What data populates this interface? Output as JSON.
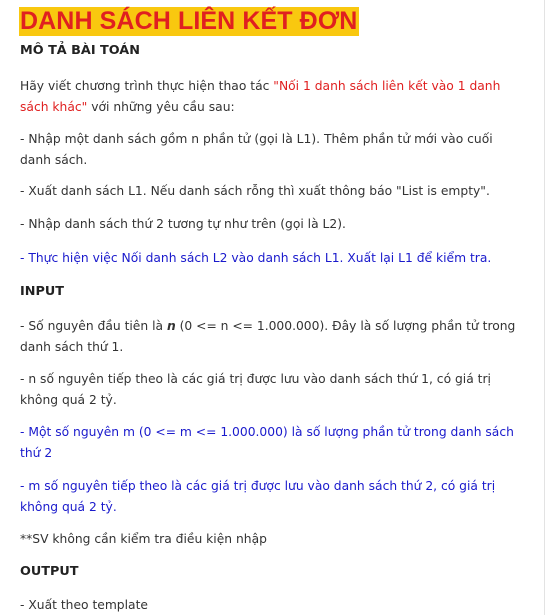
{
  "title": "DANH SÁCH LIÊN KẾT ĐƠN",
  "sections": {
    "description_heading": "MÔ TẢ BÀI TOÁN",
    "intro_prefix": "Hãy viết chương trình thực hiện thao tác ",
    "intro_highlight": "\"Nối 1 danh sách liên kết vào 1 danh sách khác\"",
    "intro_suffix": " với những yêu cầu sau:",
    "req1": "- Nhập một danh sách gồm n phần tử (gọi là L1). Thêm phần tử mới vào cuối danh sách.",
    "req2": "- Xuất danh sách L1. Nếu danh sách rỗng thì xuất thông báo \"List is empty\".",
    "req3": "- Nhập danh sách thứ 2  tương tự như trên (gọi là L2).",
    "req4": "- Thực hiện việc Nối danh sách L2 vào danh sách L1. Xuất lại L1 để kiểm tra.",
    "input_heading": "INPUT",
    "in1_prefix": " - Số nguyên đầu tiên là ",
    "in1_var": "n",
    "in1_suffix": " (0 <= n <= 1.000.000). Đây là số lượng phần tử trong danh sách thứ 1.",
    "in2": "- n số nguyên tiếp theo là các giá trị được lưu vào danh sách thứ 1, có giá trị không quá 2 tỷ.",
    "in3": "- Một số nguyên m (0 <= m <= 1.000.000) là số lượng phần tử trong danh sách thứ 2",
    "in4": "- m số nguyên tiếp theo là các giá trị được lưu vào danh sách thứ 2, có giá trị không quá 2 tỷ.",
    "note": " **SV không cần kiểm tra điều kiện nhập",
    "output_heading": "OUTPUT",
    "out1": "- Xuất theo template"
  },
  "colors": {
    "title_bg": "#f9c80f",
    "title_text": "#e02020",
    "blue_text": "#1a1acc",
    "red_text": "#e02020"
  }
}
